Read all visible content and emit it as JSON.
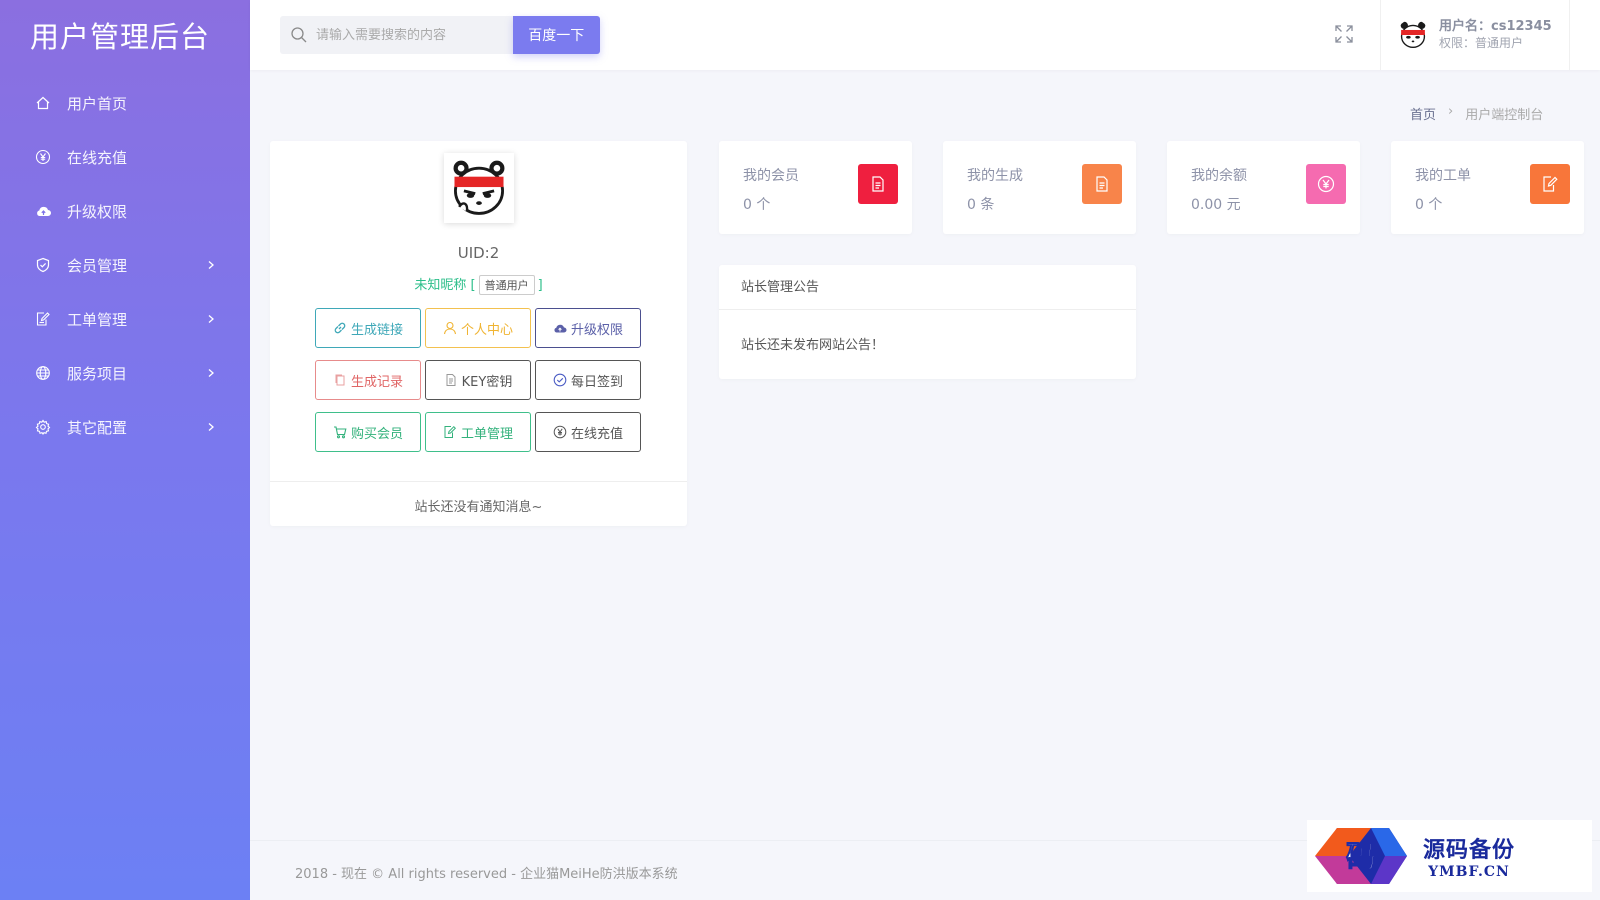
{
  "sidebar": {
    "brand": "用户管理后台",
    "items": [
      {
        "label": "用户首页",
        "icon": "home-icon",
        "has_children": false
      },
      {
        "label": "在线充值",
        "icon": "yen-circle-icon",
        "has_children": false
      },
      {
        "label": "升级权限",
        "icon": "cloud-upload-icon",
        "has_children": false
      },
      {
        "label": "会员管理",
        "icon": "shield-check-icon",
        "has_children": true
      },
      {
        "label": "工单管理",
        "icon": "edit-doc-icon",
        "has_children": true
      },
      {
        "label": "服务项目",
        "icon": "globe-icon",
        "has_children": true
      },
      {
        "label": "其它配置",
        "icon": "gear-icon",
        "has_children": true
      }
    ]
  },
  "header": {
    "search_placeholder": "请输入需要搜索的内容",
    "search_button": "百度一下",
    "user_name": "用户名：cs12345",
    "user_role": "权限：普通用户"
  },
  "breadcrumb": {
    "home": "首页",
    "separator": "›",
    "current": "用户端控制台"
  },
  "profile": {
    "uid": "UID:2",
    "nickname": "未知昵称",
    "bracket_open": "[",
    "bracket_close": "]",
    "role_tag": "普通用户",
    "buttons": [
      {
        "label": "生成链接",
        "icon": "link-icon",
        "style": "teal"
      },
      {
        "label": "个人中心",
        "icon": "user-icon",
        "style": "yellow"
      },
      {
        "label": "升级权限",
        "icon": "cloud-upload-icon",
        "style": "indigo"
      },
      {
        "label": "生成记录",
        "icon": "copy-icon",
        "style": "red"
      },
      {
        "label": "KEY密钥",
        "icon": "file-icon",
        "style": "gray"
      },
      {
        "label": "每日签到",
        "icon": "check-circle-icon",
        "style": "dark"
      },
      {
        "label": "购买会员",
        "icon": "cart-icon",
        "style": "green"
      },
      {
        "label": "工单管理",
        "icon": "edit-doc-icon",
        "style": "green"
      },
      {
        "label": "在线充值",
        "icon": "yen-circle-icon",
        "style": "dark"
      }
    ],
    "footer_message": "站长还没有通知消息~"
  },
  "stats": [
    {
      "label": "我的会员",
      "value": "0 个",
      "icon": "document-icon",
      "color": "#ef1f3f"
    },
    {
      "label": "我的生成",
      "value": "0 条",
      "icon": "document-icon",
      "color": "#f8844a"
    },
    {
      "label": "我的余额",
      "value": "0.00 元",
      "icon": "yen-circle-icon",
      "color": "#f56bb0"
    },
    {
      "label": "我的工单",
      "value": "0 个",
      "icon": "edit-doc-icon",
      "color": "#f8763a"
    }
  ],
  "notice": {
    "title": "站长管理公告",
    "body": "站长还未发布网站公告！"
  },
  "footer": {
    "text": "2018 - 现在 © All rights reserved - 企业猫MeiHe防洪版本系统"
  },
  "watermark": {
    "cn": "源码备份",
    "en": "YMBF.CN",
    "glyph": "码"
  }
}
